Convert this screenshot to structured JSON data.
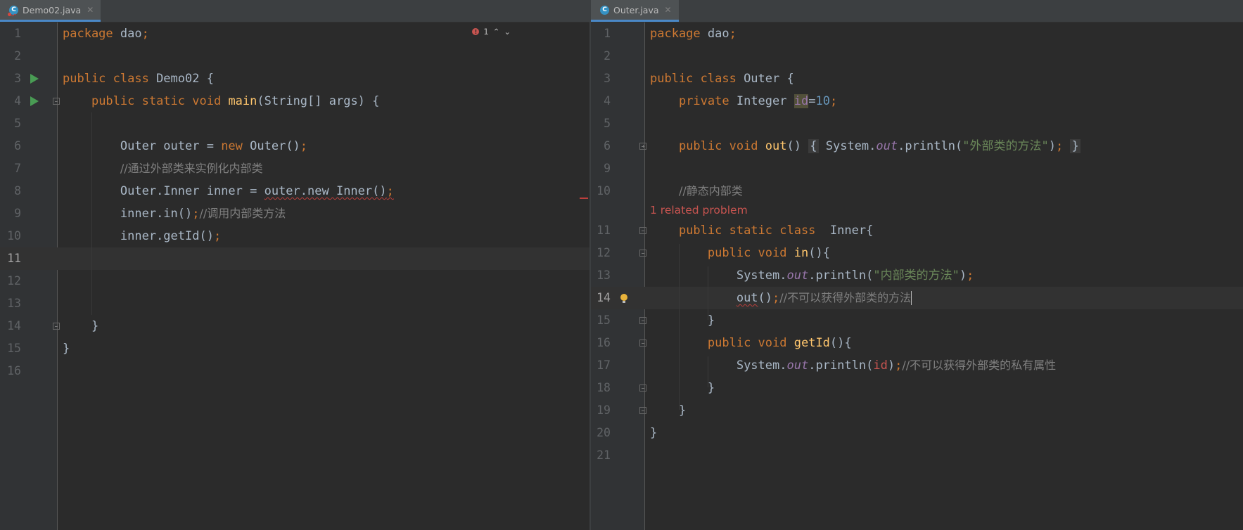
{
  "left": {
    "tab": {
      "icon": "java-class-icon",
      "label": "Demo02.java"
    },
    "inspection": {
      "errors": "1",
      "icon": "error-icon"
    },
    "line_numbers": [
      "1",
      "2",
      "3",
      "4",
      "5",
      "6",
      "7",
      "8",
      "9",
      "10",
      "11",
      "12",
      "13",
      "14",
      "15",
      "16"
    ],
    "code": {
      "l1_kw": "package",
      "l1_rest": " dao",
      "l1_semi": ";",
      "l3_kw": "public class",
      "l3_rest": " Demo02 {",
      "l4_kw": "public static void",
      "l4_fn": "main",
      "l4_rest": "(String[] args) {",
      "l6_a": "Outer outer = ",
      "l6_kw": "new",
      "l6_b": " Outer()",
      "l6_semi": ";",
      "l7_cmt": "//通过外部类来实例化内部类",
      "l8_a": "Outer.Inner inner = ",
      "l8_err": "outer.new",
      "l8_b": " Inner()",
      "l8_semi": ";",
      "l9_a": "inner.in()",
      "l9_semi": ";",
      "l9_cmt": "//调用内部类方法",
      "l10_a": "inner.getId()",
      "l10_semi": ";",
      "l14": "}",
      "l15": "}"
    }
  },
  "right": {
    "tab": {
      "icon": "java-class-icon",
      "label": "Outer.java"
    },
    "line_numbers": [
      "1",
      "2",
      "3",
      "4",
      "5",
      "6",
      "9",
      "10",
      "11",
      "12",
      "13",
      "14",
      "15",
      "16",
      "17",
      "18",
      "19",
      "20",
      "21"
    ],
    "problem_hint": "1 related problem",
    "code": {
      "l1_kw": "package",
      "l1_rest": " dao",
      "l1_semi": ";",
      "l3_kw": "public class",
      "l3_rest": " Outer {",
      "l4_kw": "private",
      "l4_type": " Integer ",
      "l4_id": "id",
      "l4_eq": "=",
      "l4_num": "10",
      "l4_semi": ";",
      "l6_kw": "public void",
      "l6_fn": "out",
      "l6_paren": "()",
      "l6_open": "{",
      "l6_body": " System.",
      "l6_fld": "out",
      "l6_call": ".println(",
      "l6_str": "\"外部类的方法\"",
      "l6_close_paren": ")",
      "l6_semi": ";",
      "l6_close": "}",
      "l10_cmt": "//静态内部类",
      "l11_kw": "public static class",
      "l11_rest": "  Inner{",
      "l12_kw": "public void",
      "l12_fn": "in",
      "l12_rest": "(){",
      "l13_a": "System.",
      "l13_fld": "out",
      "l13_b": ".println(",
      "l13_str": "\"内部类的方法\"",
      "l13_c": ")",
      "l13_semi": ";",
      "l14_err": "out",
      "l14_a": "()",
      "l14_semi": ";",
      "l14_cmt": "//不可以获得外部类的方法",
      "l15": "}",
      "l16_kw": "public void",
      "l16_fn": "getId",
      "l16_rest": "(){",
      "l17_a": "System.",
      "l17_fld": "out",
      "l17_b": ".println(",
      "l17_var": "id",
      "l17_c": ")",
      "l17_semi": ";",
      "l17_cmt": "//不可以获得外部类的私有属性",
      "l18": "}",
      "l19": "}",
      "l20": "}"
    }
  },
  "colors": {
    "background": "#2b2b2b",
    "keyword": "#cc7832",
    "method": "#ffc66d",
    "string": "#6a8759",
    "number": "#6897bb",
    "comment": "#808080",
    "field": "#9876aa",
    "error": "#bc3f3c",
    "run_icon": "#499c54"
  }
}
